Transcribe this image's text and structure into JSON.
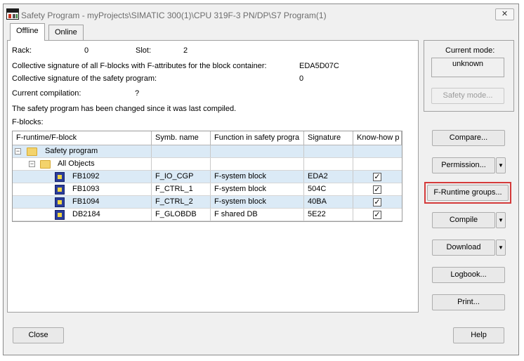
{
  "window": {
    "title": "Safety Program - myProjects\\SIMATIC 300(1)\\CPU 319F-3 PN/DP\\S7 Program(1)",
    "close_glyph": "✕"
  },
  "tabs": [
    {
      "label": "Offline",
      "active": true
    },
    {
      "label": "Online",
      "active": false
    }
  ],
  "info": {
    "rack_label": "Rack:",
    "rack_value": "0",
    "slot_label": "Slot:",
    "slot_value": "2",
    "collective_fblocks_label": "Collective signature of all F-blocks with F-attributes for the block container:",
    "collective_fblocks_value": "EDA5D07C",
    "collective_program_label": "Collective signature of the safety program:",
    "collective_program_value": "0",
    "current_compilation_label": "Current compilation:",
    "current_compilation_value": "?",
    "changed_message": "The safety program has been changed since it was last compiled.",
    "fblocks_label": "F-blocks:"
  },
  "table": {
    "headers": [
      "F-runtime/F-block",
      "Symb. name",
      "Function in safety progra",
      "Signature",
      "Know-how p"
    ],
    "tree": [
      {
        "label": "Safety program",
        "expander": "−"
      },
      {
        "label": "All Objects",
        "expander": "−"
      }
    ],
    "rows": [
      {
        "block": "FB1092",
        "symbol": "F_IO_CGP",
        "function": "F-system block",
        "signature": "EDA2",
        "know_how": "✓",
        "selected": true
      },
      {
        "block": "FB1093",
        "symbol": "F_CTRL_1",
        "function": "F-system block",
        "signature": "504C",
        "know_how": "✓",
        "selected": false
      },
      {
        "block": "FB1094",
        "symbol": "F_CTRL_2",
        "function": "F-system block",
        "signature": "40BA",
        "know_how": "✓",
        "selected": true
      },
      {
        "block": "DB2184",
        "symbol": "F_GLOBDB",
        "function": "F shared DB",
        "signature": "5E22",
        "know_how": "✓",
        "selected": false
      }
    ]
  },
  "mode": {
    "label": "Current mode:",
    "value": "unknown",
    "safety_mode_button": "Safety mode..."
  },
  "buttons": {
    "compare": "Compare...",
    "permission": "Permission...",
    "f_runtime_groups": "F-Runtime groups...",
    "compile": "Compile",
    "download": "Download",
    "logbook": "Logbook...",
    "print": "Print...",
    "close": "Close",
    "help": "Help",
    "dropdown_glyph": "▼"
  },
  "colors": {
    "highlight": "#d43a3a",
    "selected_row": "#dbeaf6"
  }
}
